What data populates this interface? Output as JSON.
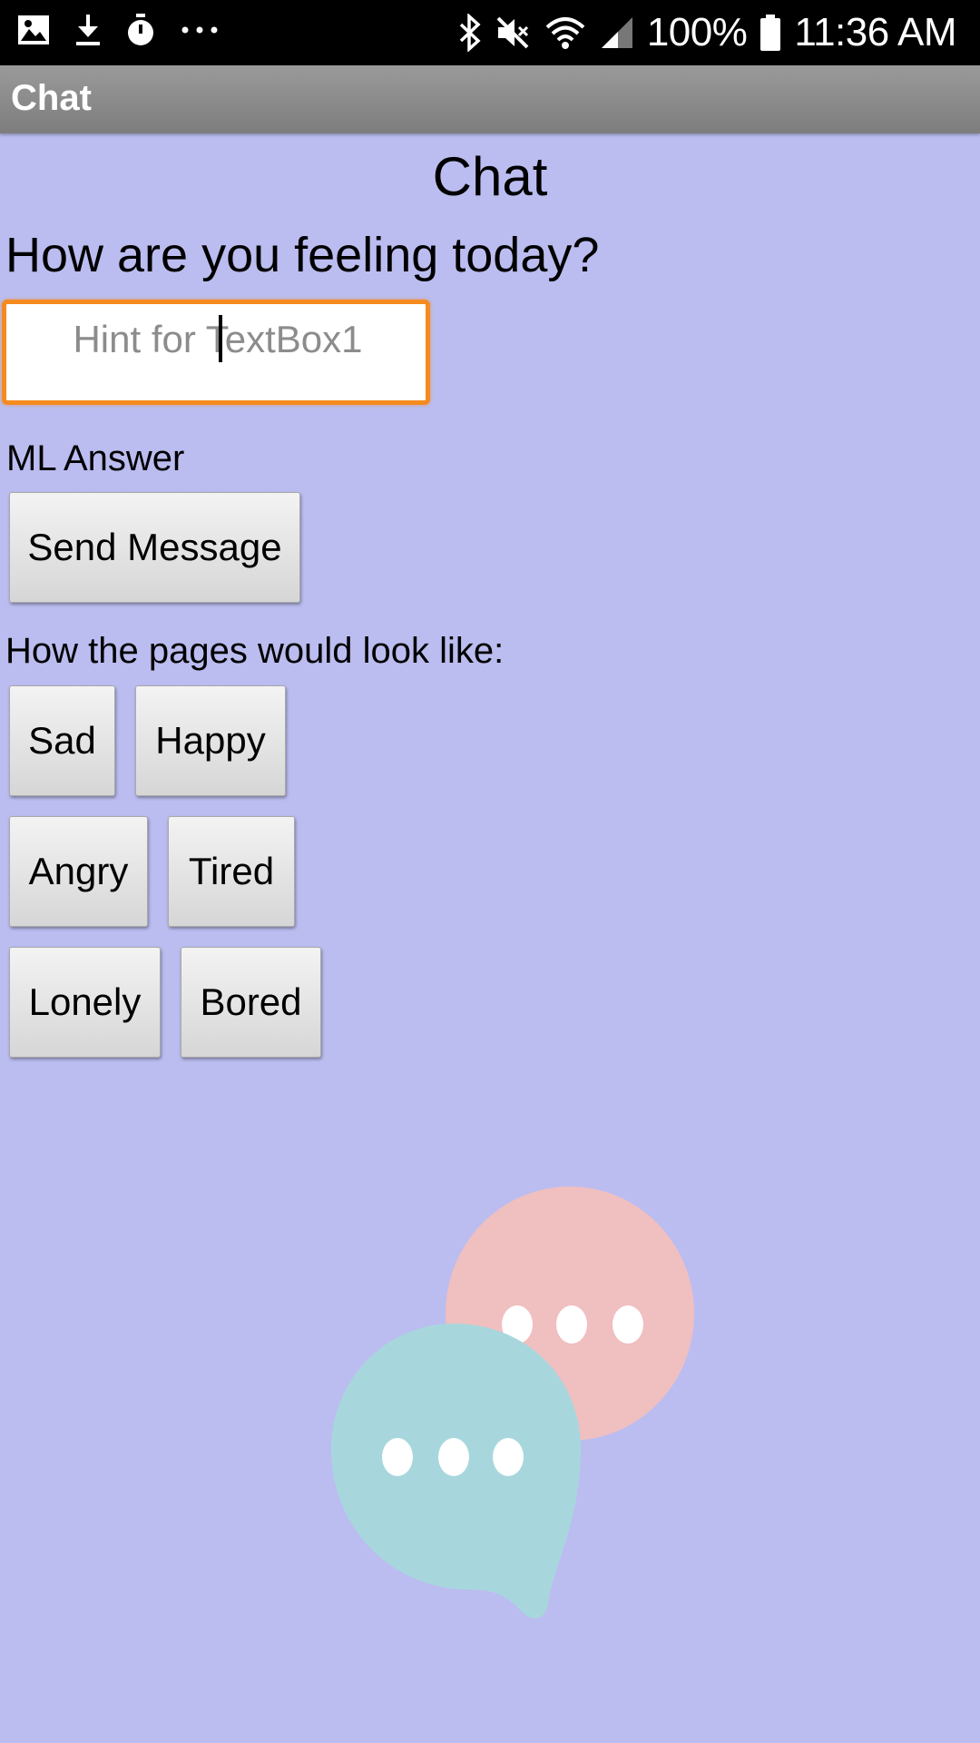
{
  "status_bar": {
    "icons_left": [
      "image-icon",
      "download-icon",
      "stopwatch-icon",
      "more-icon"
    ],
    "icons_right": [
      "bluetooth-icon",
      "mute-icon",
      "wifi-icon",
      "signal-icon"
    ],
    "battery": "100%",
    "time": "11:36 AM"
  },
  "app_bar": {
    "title": "Chat"
  },
  "screen": {
    "heading": "Chat",
    "question": "How are you feeling today?",
    "textbox": {
      "placeholder": "Hint for TextBox1",
      "value": ""
    },
    "ml_answer": "ML Answer",
    "send_button": "Send Message",
    "pages_label": "How the pages would look like:",
    "mood_buttons": [
      "Sad",
      "Happy",
      "Angry",
      "Tired",
      "Lonely",
      "Bored"
    ]
  },
  "colors": {
    "background": "#bbbdf0",
    "textbox_focus": "#f58a1f",
    "bubble_pink": "#f0bfc0",
    "bubble_teal": "#a7d7dd"
  }
}
